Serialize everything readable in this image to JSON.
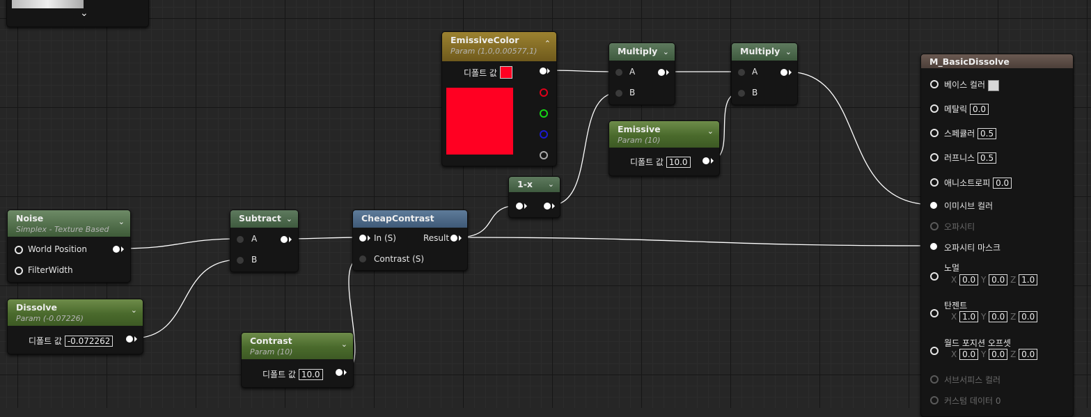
{
  "colors": {
    "accent_red": "#ff0022",
    "swatch_base": "#d8d8d8"
  },
  "top_node": {
    "chevron": "⌄"
  },
  "emissive_color": {
    "title": "EmissiveColor",
    "sub": "Param (1,0,0.00577,1)",
    "default_label": "디폴트 값"
  },
  "multiply1": {
    "title": "Multiply",
    "a": "A",
    "b": "B"
  },
  "multiply2": {
    "title": "Multiply",
    "a": "A",
    "b": "B"
  },
  "emissive": {
    "title": "Emissive",
    "sub": "Param (10)",
    "default_label": "디폴트 값",
    "value": "10.0"
  },
  "one_minus_x": {
    "title": "1-x"
  },
  "noise": {
    "title": "Noise",
    "sub": "Simplex - Texture Based",
    "pins": [
      "World Position",
      "FilterWidth"
    ]
  },
  "subtract": {
    "title": "Subtract",
    "a": "A",
    "b": "B"
  },
  "cheap_contrast": {
    "title": "CheapContrast",
    "in": "In (S)",
    "result": "Result",
    "contrast": "Contrast (S)"
  },
  "dissolve": {
    "title": "Dissolve",
    "sub": "Param (-0.07226)",
    "default_label": "디폴트 값",
    "value": "-0.072262"
  },
  "contrast": {
    "title": "Contrast",
    "sub": "Param (10)",
    "default_label": "디폴트 값",
    "value": "10.0"
  },
  "material": {
    "title": "M_BasicDissolve",
    "base_color": "베이스 컬러",
    "metallic": "메탈릭",
    "metallic_val": "0.0",
    "specular": "스페큘러",
    "specular_val": "0.5",
    "roughness": "러프니스",
    "roughness_val": "0.5",
    "anisotropy": "애니소트로피",
    "anisotropy_val": "0.0",
    "emissive": "이미시브 컬러",
    "opacity": "오파시티",
    "opacity_mask": "오파시티 마스크",
    "normal": "노멀",
    "normal_x": "0.0",
    "normal_y": "0.0",
    "normal_z": "1.0",
    "tangent": "탄젠트",
    "tangent_x": "1.0",
    "tangent_y": "0.0",
    "tangent_z": "0.0",
    "wpo": "월드 포지션 오프셋",
    "wpo_x": "0.0",
    "wpo_y": "0.0",
    "wpo_z": "0.0",
    "subsurface": "서브서피스 컬러",
    "custom_data": "커스텀 데이터 0",
    "x": "X",
    "y": "Y",
    "z": "Z"
  }
}
